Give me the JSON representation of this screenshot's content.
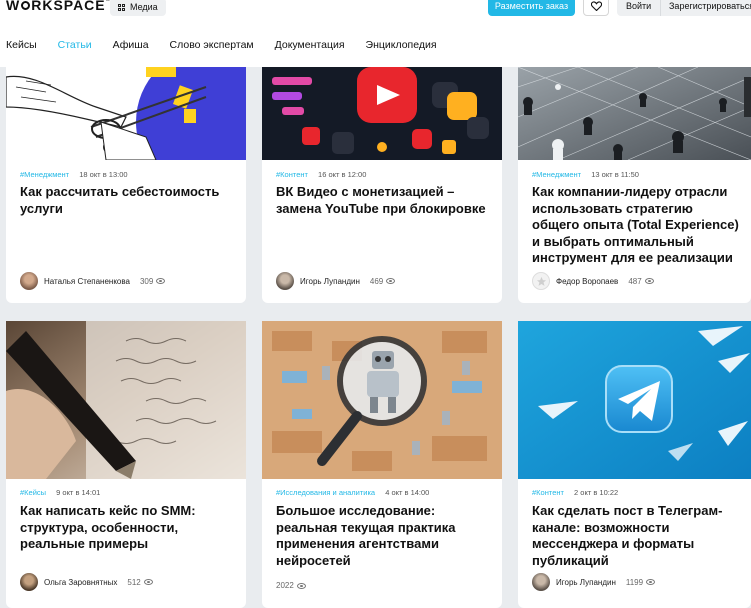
{
  "header": {
    "logo": "WORKSPACE",
    "media": "Медиа",
    "post_order": "Разместить заказ",
    "login": "Войти",
    "register": "Зарегистрироваться"
  },
  "nav": [
    "Кейсы",
    "Статьи",
    "Афиша",
    "Слово экспертам",
    "Документация",
    "Энциклопедия"
  ],
  "nav_active": "Статьи",
  "accent_color": "#22b8e6",
  "cards": [
    {
      "category": "#Менеджмент",
      "date": "18 окт в 13:00",
      "title": "Как рассчитать себестоимость услуги",
      "author": "Наталья Степаненкова",
      "views": "309"
    },
    {
      "category": "#Контент",
      "date": "16 окт в 12:00",
      "title": "ВК Видео с монетизацией – замена YouTube при блокировке",
      "author": "Игорь Лупандин",
      "views": "469"
    },
    {
      "category": "#Менеджмент",
      "date": "13 окт в 11:50",
      "title": "Как компании-лидеру отрасли использовать стратегию общего опыта (Total Experience) и выбрать оптимальный инструмент для ее реализации",
      "author": "Федор Воропаев",
      "views": "487"
    },
    {
      "category": "#Кейсы",
      "date": "9 окт в 14:01",
      "title": "Как написать кейс по SMM: структура, особенности, реальные примеры",
      "author": "Ольга Заровнятных",
      "views": "512"
    },
    {
      "category": "#Исследования и аналитика",
      "date": "4 окт в 14:00",
      "title": "Большое исследование: реальная текущая практика применения агентствами нейросетей",
      "author": "",
      "views": "2022"
    },
    {
      "category": "#Контент",
      "date": "2 окт в 10:22",
      "title": "Как сделать пост в Телеграм-канале: возможности мессенджера и форматы публикаций",
      "author": "Игорь Лупандин",
      "views": "1199"
    }
  ]
}
